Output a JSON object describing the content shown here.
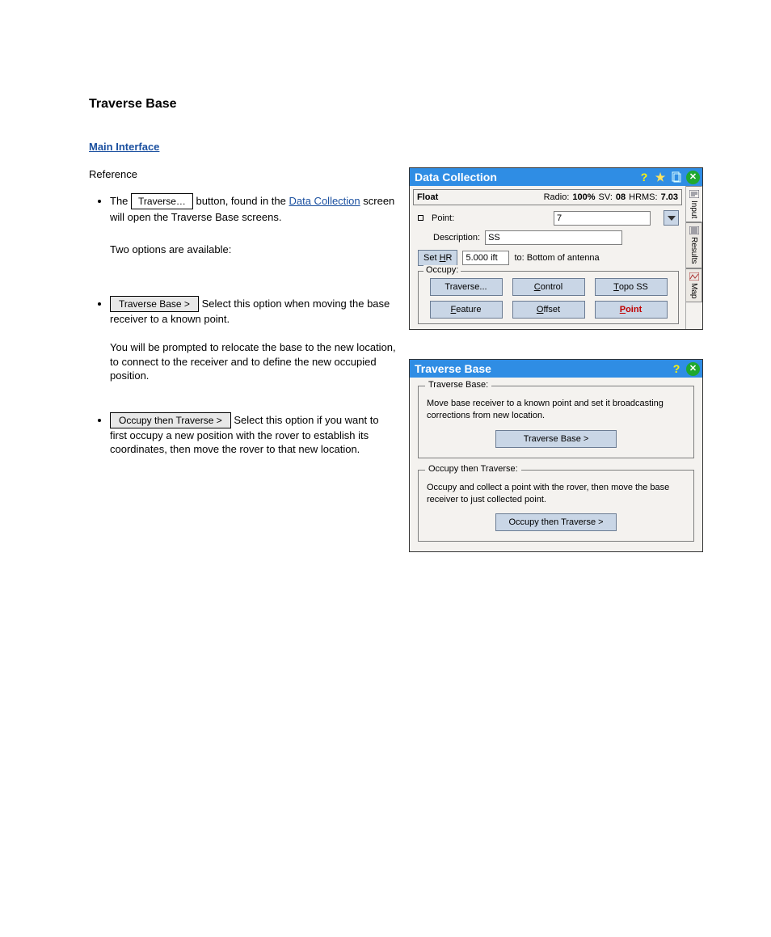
{
  "doc": {
    "title": "Traverse Base",
    "sectionTitle": "Main Interface",
    "ref": "Reference"
  },
  "intro": {
    "line1a": "The ",
    "traverseLabel": "Traverse…",
    "line1b": " button, found in the ",
    "dcLink": "Data Collection",
    "line1c": " screen will open the Traverse Base screens.",
    "line2": "Two options are available:"
  },
  "option1": {
    "label": "Traverse Base >",
    "text1": "Select this option when moving the base receiver to a known point.",
    "text2": "You will be prompted to relocate the base to the new location, to connect to the receiver and to define the new occupied position."
  },
  "option2": {
    "label": "Occupy then Traverse >",
    "text": "Select this option if you want to first occupy a new position with the rover to establish its coordinates, then move the rover to that new location."
  },
  "dc": {
    "title": "Data Collection",
    "status": {
      "mode": "Float",
      "radioLabel": "Radio:",
      "radio": "100%",
      "svLabel": "SV:",
      "sv": "08",
      "hrmsLabel": "HRMS:",
      "hrms": "7.03"
    },
    "pointLabel": "Point:",
    "pointValue": "7",
    "descLabel": "Description:",
    "descValue": "SS",
    "setHrLabel": "Set HR",
    "hrValue": "5.000 ift",
    "toLabel": "to: Bottom of antenna",
    "occupyLegend": "Occupy:",
    "occupy": {
      "traverse": "Traverse...",
      "control": "Control",
      "topo": "Topo SS",
      "feature": "Feature",
      "offset": "Offset",
      "point": "Point"
    },
    "tabs": {
      "input": "Input",
      "results": "Results",
      "map": "Map"
    }
  },
  "tb": {
    "title": "Traverse Base",
    "g1": {
      "legend": "Traverse Base:",
      "text": "Move base receiver to a known point and set it broadcasting corrections from new location.",
      "button": "Traverse Base >"
    },
    "g2": {
      "legend": "Occupy then Traverse:",
      "text": "Occupy and collect a point with the rover, then move the base receiver to just collected point.",
      "button": "Occupy then Traverse >"
    }
  }
}
